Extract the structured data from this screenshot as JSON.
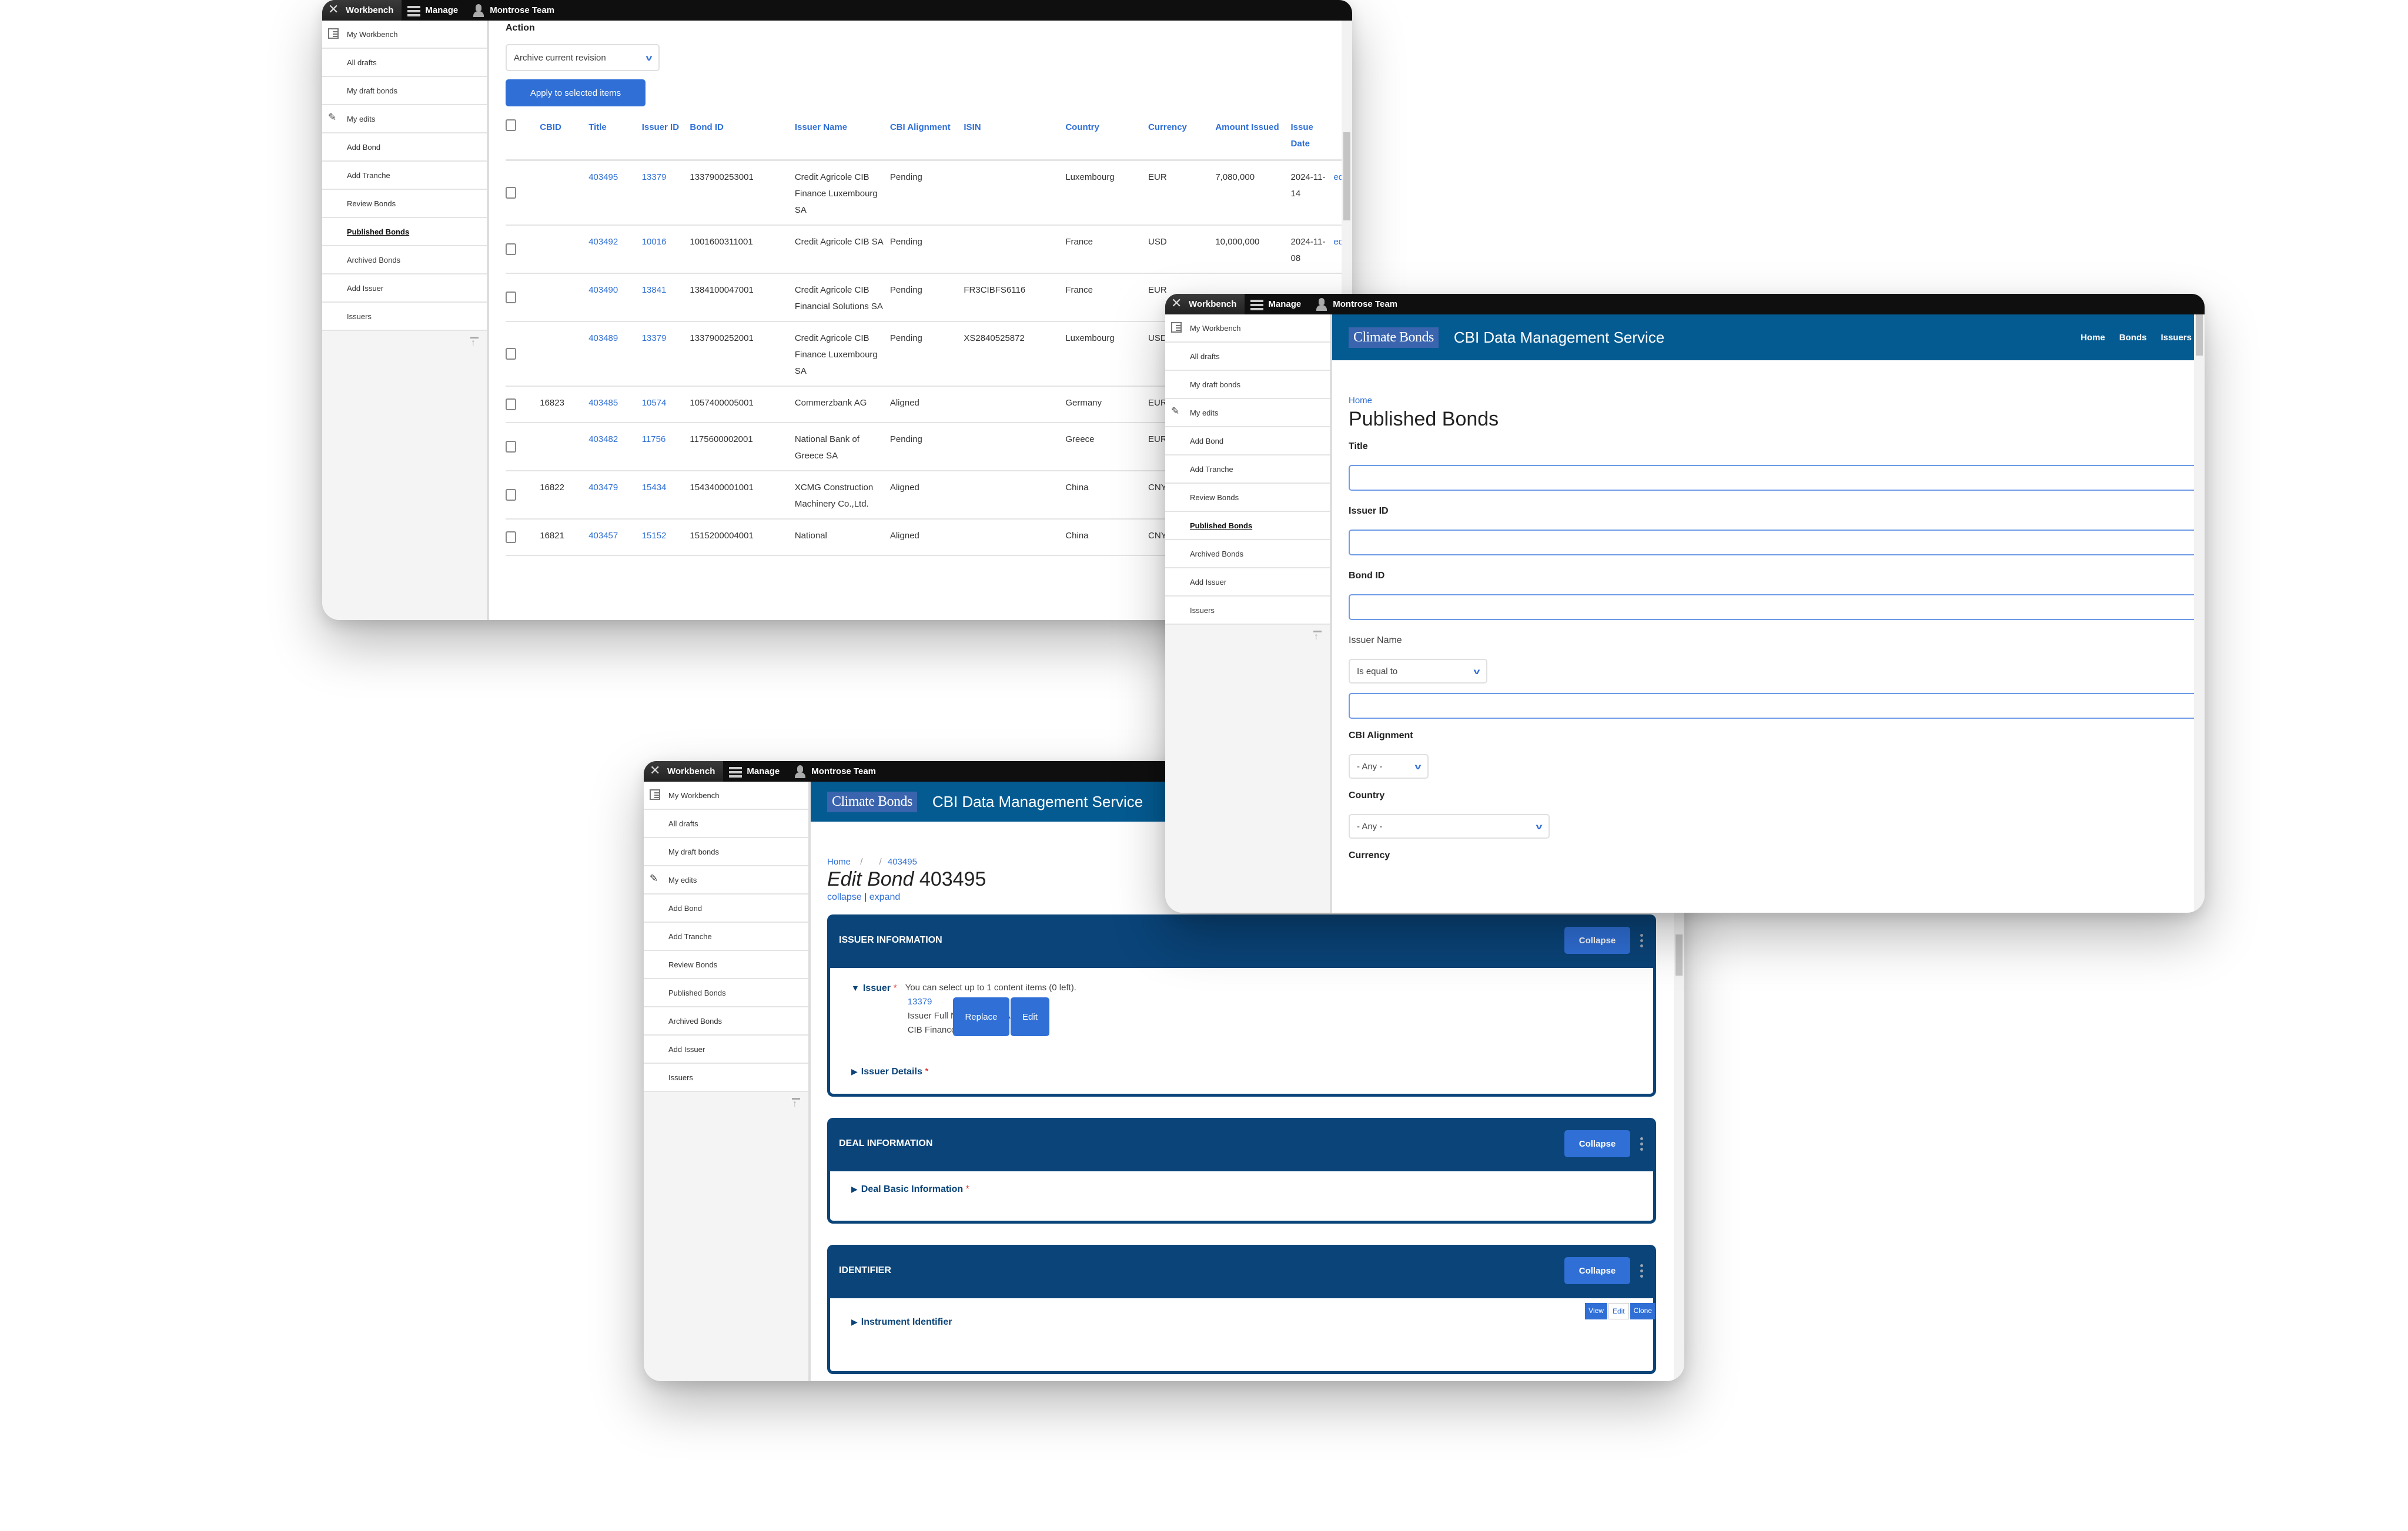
{
  "toolbar": {
    "workbench": "Workbench",
    "manage": "Manage",
    "user": "Montrose Team"
  },
  "sidebar": {
    "items": [
      {
        "label": "My Workbench",
        "icon": "checklist-icon"
      },
      {
        "label": "All drafts"
      },
      {
        "label": "My draft bonds"
      },
      {
        "label": "My edits",
        "icon": "pencil-icon"
      },
      {
        "label": "Add Bond"
      },
      {
        "label": "Add Tranche"
      },
      {
        "label": "Review Bonds"
      },
      {
        "label": "Published Bonds"
      },
      {
        "label": "Archived Bonds"
      },
      {
        "label": "Add Issuer"
      },
      {
        "label": "Issuers"
      }
    ]
  },
  "brand": {
    "logo_text": "Climate Bonds",
    "site_title": "CBI Data Management Service",
    "nav": [
      "Home",
      "Bonds",
      "Issuers"
    ],
    "colors": {
      "header": "#045b92",
      "section": "#0a4479",
      "accent": "#2f6fd6",
      "toolbar": "#0f0f0f"
    }
  },
  "window1": {
    "action_label": "Action",
    "action_select": "Archive current revision",
    "apply_button": "Apply to selected items",
    "columns": [
      "CBID",
      "Title",
      "Issuer ID",
      "Bond ID",
      "Issuer Name",
      "CBI Alignment",
      "ISIN",
      "Country",
      "Currency",
      "Amount Issued",
      "Issue Date",
      ""
    ],
    "rows": [
      {
        "cbid": "",
        "title": "403495",
        "issuer_id": "13379",
        "bond_id": "1337900253001",
        "issuer_name": "Credit Agricole CIB Finance Luxembourg SA",
        "alignment": "Pending",
        "isin": "",
        "country": "Luxembourg",
        "currency": "EUR",
        "amount": "7,080,000",
        "date": "2024-11-14",
        "action": "edit"
      },
      {
        "cbid": "",
        "title": "403492",
        "issuer_id": "10016",
        "bond_id": "1001600311001",
        "issuer_name": "Credit Agricole CIB SA",
        "alignment": "Pending",
        "isin": "",
        "country": "France",
        "currency": "USD",
        "amount": "10,000,000",
        "date": "2024-11-08",
        "action": "edit"
      },
      {
        "cbid": "",
        "title": "403490",
        "issuer_id": "13841",
        "bond_id": "1384100047001",
        "issuer_name": "Credit Agricole CIB Financial Solutions SA",
        "alignment": "Pending",
        "isin": "FR3CIBFS6116",
        "country": "France",
        "currency": "EUR",
        "amount": "",
        "date": "",
        "action": ""
      },
      {
        "cbid": "",
        "title": "403489",
        "issuer_id": "13379",
        "bond_id": "1337900252001",
        "issuer_name": "Credit Agricole CIB Finance Luxembourg SA",
        "alignment": "Pending",
        "isin": "XS2840525872",
        "country": "Luxembourg",
        "currency": "USD",
        "amount": "",
        "date": "",
        "action": ""
      },
      {
        "cbid": "16823",
        "title": "403485",
        "issuer_id": "10574",
        "bond_id": "1057400005001",
        "issuer_name": "Commerzbank AG",
        "alignment": "Aligned",
        "isin": "",
        "country": "Germany",
        "currency": "EUR",
        "amount": "",
        "date": "",
        "action": ""
      },
      {
        "cbid": "",
        "title": "403482",
        "issuer_id": "11756",
        "bond_id": "1175600002001",
        "issuer_name": "National Bank of Greece SA",
        "alignment": "Pending",
        "isin": "",
        "country": "Greece",
        "currency": "EUR",
        "amount": "",
        "date": "",
        "action": ""
      },
      {
        "cbid": "16822",
        "title": "403479",
        "issuer_id": "15434",
        "bond_id": "1543400001001",
        "issuer_name": "XCMG Construction Machinery Co.,Ltd.",
        "alignment": "Aligned",
        "isin": "",
        "country": "China",
        "currency": "CNY",
        "amount": "",
        "date": "",
        "action": ""
      },
      {
        "cbid": "16821",
        "title": "403457",
        "issuer_id": "15152",
        "bond_id": "1515200004001",
        "issuer_name": "National",
        "alignment": "Aligned",
        "isin": "",
        "country": "China",
        "currency": "CNY",
        "amount": "",
        "date": "",
        "action": ""
      }
    ]
  },
  "window2": {
    "breadcrumb": "Home",
    "page_title": "Published Bonds",
    "filters": {
      "title_label": "Title",
      "title_value": "",
      "issuer_id_label": "Issuer ID",
      "issuer_id_value": "",
      "bond_id_label": "Bond ID",
      "bond_id_value": "",
      "issuer_name_label": "Issuer Name",
      "issuer_name_operator": "Is equal to",
      "issuer_name_value": "",
      "alignment_label": "CBI Alignment",
      "alignment_value": "- Any -",
      "country_label": "Country",
      "country_value": "- Any -",
      "currency_label": "Currency"
    }
  },
  "window3": {
    "breadcrumb": [
      "Home",
      "/",
      "/",
      "403495"
    ],
    "title_italic": "Edit Bond",
    "title_id": "403495",
    "collapse_link": "collapse",
    "expand_link": "expand",
    "link_sep": "|",
    "sections": [
      {
        "title": "ISSUER INFORMATION",
        "button": "Collapse"
      },
      {
        "title": "DEAL INFORMATION",
        "button": "Collapse"
      },
      {
        "title": "IDENTIFIER",
        "button": "Collapse"
      }
    ],
    "issuer": {
      "label": "Issuer",
      "hint": "You can select up to 1 content items (0 left).",
      "id": "13379",
      "full_name_label": "Issuer Full Name:",
      "full_name": "Credit Agricole CIB Finance Luxembourg SA",
      "replace_button": "Replace",
      "edit_button": "Edit",
      "details_label": "Issuer Details"
    },
    "deal_basic_label": "Deal Basic Information",
    "instrument_label": "Instrument Identifier",
    "instrument_buttons": [
      "View",
      "Edit",
      "Clone"
    ],
    "required_mark": "*"
  }
}
